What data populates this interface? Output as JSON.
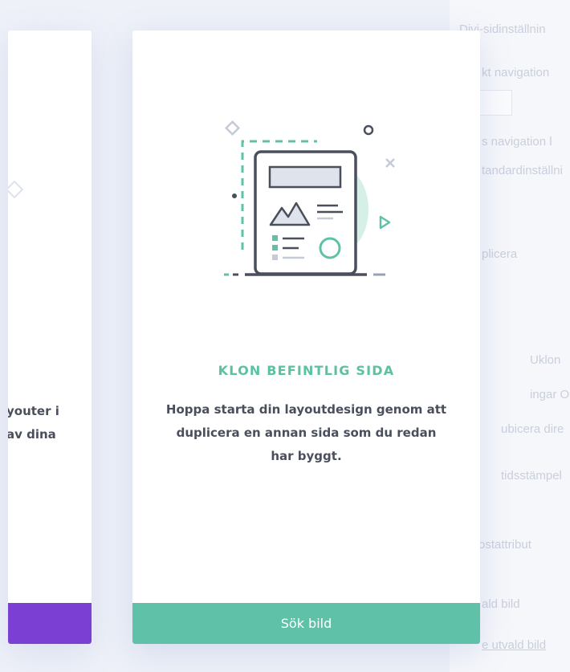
{
  "left_card": {
    "text": "youter i\nav dina",
    "button_color": "#7b3fd4"
  },
  "main_card": {
    "title": "KLON BEFINTLIG SIDA",
    "description": "Hoppa starta din layoutdesign genom att duplicera en annan sida som du redan har byggt.",
    "button_label": "Sök bild",
    "accent_color": "#5fc2a8",
    "illustration_icon": "page-clone-illustration"
  },
  "background_panel": {
    "lines": [
      "Divi-sidinställnin",
      "kt navigation",
      "s navigation l",
      "tandardinställni",
      "plicera",
      "Uklon",
      "ingar Off",
      "ubicera dire",
      "tidsstämpel",
      "ostattribut",
      "ald bild",
      "e utvald bild"
    ]
  }
}
